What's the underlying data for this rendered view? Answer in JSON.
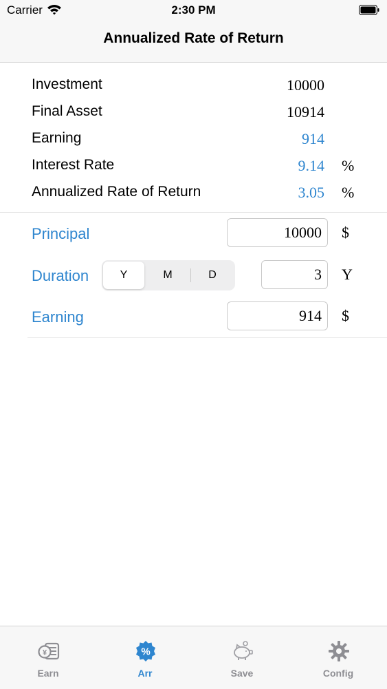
{
  "status_bar": {
    "carrier": "Carrier",
    "time": "2:30 PM"
  },
  "nav": {
    "title": "Annualized Rate of Return"
  },
  "summary": {
    "investment": {
      "label": "Investment",
      "value": "10000"
    },
    "final_asset": {
      "label": "Final Asset",
      "value": "10914"
    },
    "earning": {
      "label": "Earning",
      "value": "914"
    },
    "interest_rate": {
      "label": "Interest Rate",
      "value": "9.14",
      "unit": "%"
    },
    "annualized": {
      "label": "Annualized Rate of Return",
      "value": "3.05",
      "unit": "%"
    }
  },
  "inputs": {
    "principal": {
      "label": "Principal",
      "value": "10000",
      "unit": "$"
    },
    "duration": {
      "label": "Duration",
      "options": [
        "Y",
        "M",
        "D"
      ],
      "selected": "Y",
      "value": "3",
      "unit": "Y"
    },
    "earning": {
      "label": "Earning",
      "value": "914",
      "unit": "$"
    }
  },
  "tabs": [
    {
      "label": "Earn",
      "icon": "money-icon"
    },
    {
      "label": "Arr",
      "icon": "percent-badge-icon"
    },
    {
      "label": "Save",
      "icon": "piggy-bank-icon"
    },
    {
      "label": "Config",
      "icon": "gear-icon"
    }
  ],
  "colors": {
    "accent": "#2f86cf",
    "inactive": "#8e8e93"
  }
}
